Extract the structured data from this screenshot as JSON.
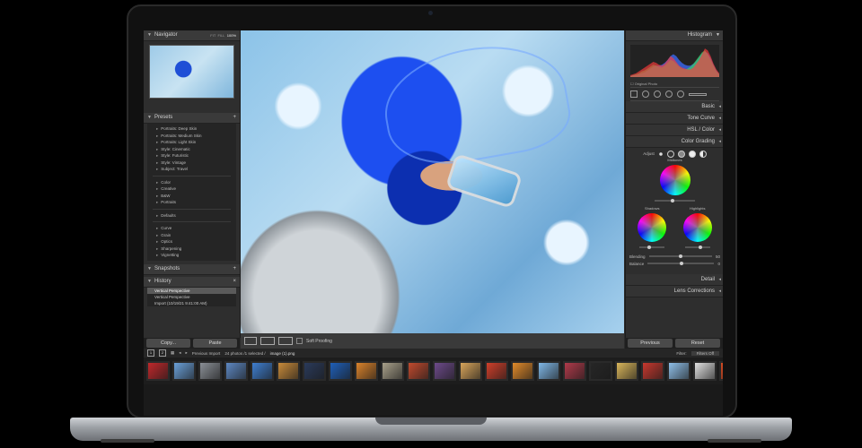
{
  "navigator": {
    "title": "Navigator",
    "zoom_options": [
      "FIT",
      "FILL",
      "100%"
    ]
  },
  "presets": {
    "title": "Presets",
    "items": [
      "Portraits: Deep Skin",
      "Portraits: Medium Skin",
      "Portraits: Light Skin",
      "Style: Cinematic",
      "Style: Futuristic",
      "Style: Vintage",
      "Subject: Travel"
    ],
    "groups": [
      "Color",
      "Creative",
      "B&W",
      "Portraits"
    ],
    "defaults": "Defaults",
    "effects": [
      "Curve",
      "Grain",
      "Optics",
      "Sharpening",
      "Vignetting"
    ]
  },
  "snapshots": {
    "title": "Snapshots"
  },
  "history": {
    "title": "History",
    "items": [
      "Vertical Perspective",
      "Vertical Perspective",
      "Import (10/19/21 9:41:00 AM)"
    ]
  },
  "left_buttons": {
    "copy": "Copy...",
    "paste": "Paste"
  },
  "toolbar": {
    "soft_proofing": "Soft Proofing"
  },
  "histogram": {
    "title": "Histogram",
    "original_photo": "Original Photo",
    "bars_red": [
      2,
      3,
      4,
      6,
      8,
      10,
      12,
      14,
      16,
      15,
      13,
      12,
      14,
      18,
      22,
      20,
      16,
      12,
      10,
      9,
      8,
      8,
      10,
      14,
      18,
      24,
      30,
      28,
      22,
      14,
      8,
      4
    ],
    "bars_green": [
      1,
      2,
      3,
      4,
      6,
      7,
      9,
      11,
      13,
      12,
      11,
      10,
      12,
      15,
      18,
      17,
      14,
      11,
      9,
      8,
      9,
      11,
      14,
      18,
      22,
      26,
      28,
      24,
      18,
      12,
      6,
      3
    ],
    "bars_blue": [
      1,
      2,
      2,
      3,
      4,
      5,
      7,
      9,
      11,
      12,
      12,
      13,
      15,
      18,
      22,
      24,
      22,
      18,
      15,
      13,
      12,
      12,
      14,
      17,
      21,
      25,
      27,
      25,
      20,
      13,
      7,
      3
    ]
  },
  "right_sections": [
    "Basic",
    "Tone Curve",
    "HSL / Color",
    "Color Grading"
  ],
  "color_grading": {
    "adjust_label": "Adjust",
    "midtones": "Midtones",
    "shadows": "Shadows",
    "highlights": "Highlights",
    "blending_label": "Blending",
    "blending_value": "50",
    "balance_label": "Balance",
    "balance_value": "0"
  },
  "right_sections_lower": [
    "Detail",
    "Lens Corrections"
  ],
  "right_buttons": {
    "previous": "Previous",
    "reset": "Reset"
  },
  "filmbar": {
    "page_1": "1",
    "page_2": "2",
    "source": "Previous Import",
    "count_text": "24 photos /1 selected /",
    "filename": "image (1).png",
    "filter_label": "Filter:",
    "filter_value": "Filters Off"
  },
  "colors": {
    "thumbs": [
      "#c0282b",
      "#6aa0d8",
      "#8a8f96",
      "#5d88c2",
      "#3f7fd0",
      "#c78a3a",
      "#2a3a5a",
      "#1f5fb8",
      "#d9822b",
      "#a8a08a",
      "#c04a2e",
      "#6d4a8a",
      "#d7a45a",
      "#cf3f2a",
      "#e08a2a",
      "#7fb7e6",
      "#b03a4a",
      "#262626",
      "#d8b55a",
      "#c7382e",
      "#8fbfe8",
      "#e0e0e0",
      "#d44a22",
      "#5fa2de"
    ]
  }
}
